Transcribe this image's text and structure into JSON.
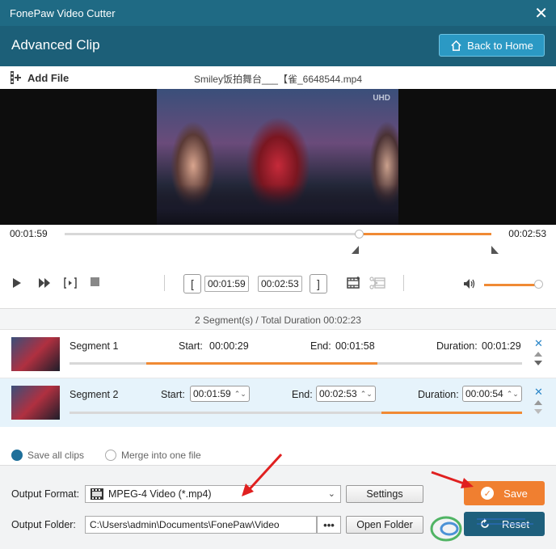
{
  "app": {
    "title": "FonePaw Video Cutter",
    "close_glyph": "✕"
  },
  "header": {
    "title": "Advanced Clip",
    "home_button": "Back to Home"
  },
  "filebar": {
    "add_file": "Add File",
    "filename": "Smiley饭拍舞台___【雀_6648544.mp4"
  },
  "video": {
    "logo_text": "UHD"
  },
  "timeline": {
    "start": "00:01:59",
    "end": "00:02:53",
    "playhead": 0.69,
    "sel_start": 0.69,
    "sel_end": 1.0
  },
  "controls": {
    "left_bracket": "[",
    "right_bracket": "]",
    "start_time": "00:01:59",
    "end_time": "00:02:53",
    "volume": 1.0
  },
  "summary": "2 Segment(s) / Total Duration 00:02:23",
  "segments": [
    {
      "name": "Segment 1",
      "start_label": "Start:",
      "start": "00:00:29",
      "end_label": "End:",
      "end": "00:01:58",
      "duration_label": "Duration:",
      "duration": "00:01:29",
      "bar_start": 0.17,
      "bar_end": 0.68
    },
    {
      "name": "Segment 2",
      "start_label": "Start:",
      "start": "00:01:59",
      "end_label": "End:",
      "end": "00:02:53",
      "duration_label": "Duration:",
      "duration": "00:00:54",
      "bar_start": 0.69,
      "bar_end": 1.0
    }
  ],
  "mode": {
    "save_all": "Save all clips",
    "merge": "Merge into one file",
    "selected": "save_all"
  },
  "output": {
    "format_label": "Output Format:",
    "format_value": "MPEG-4 Video (*.mp4)",
    "settings": "Settings",
    "folder_label": "Output Folder:",
    "folder_value": "C:\\Users\\admin\\Documents\\FonePaw\\Video",
    "dots": "•••",
    "open_folder": "Open Folder",
    "save": "Save",
    "reset": "Reset"
  },
  "colors": {
    "accent_orange": "#f07f30",
    "header_blue": "#1c5f78",
    "titlebar_blue": "#1f6a84",
    "home_button": "#2b99c4"
  }
}
